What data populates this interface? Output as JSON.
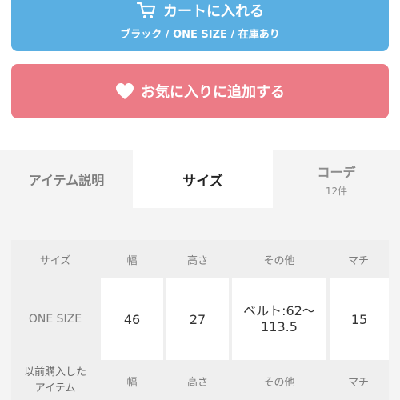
{
  "cart": {
    "label": "カートに入れる",
    "variant": "ブラック / ONE SIZE / 在庫あり",
    "icon": "cart-icon",
    "color": "#5aafe2"
  },
  "favorite": {
    "label": "お気に入りに追加する",
    "icon": "heart-icon",
    "color": "#ec7b86"
  },
  "tabs": {
    "description": "アイテム説明",
    "size": "サイズ",
    "coordinate": "コーデ",
    "coordinate_count": "12件"
  },
  "size_table": {
    "headers": [
      "サイズ",
      "幅",
      "高さ",
      "その他",
      "マチ"
    ],
    "row": {
      "size": "ONE SIZE",
      "width": "46",
      "height": "27",
      "other_line1": "ベルト:62〜",
      "other_line2": "113.5",
      "gusset": "15"
    },
    "compare_headers": [
      "以前購入した",
      "アイテム",
      "幅",
      "高さ",
      "その他",
      "マチ"
    ]
  }
}
